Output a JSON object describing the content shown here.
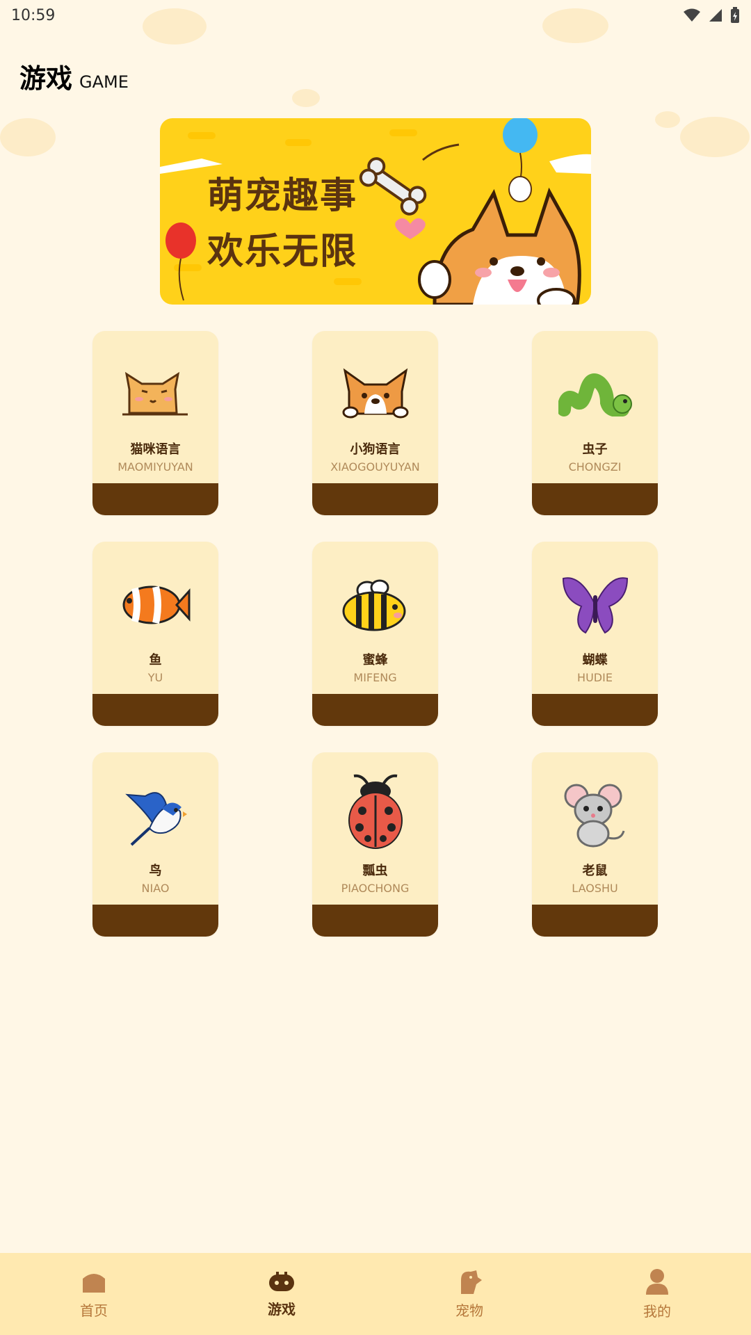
{
  "status": {
    "time": "10:59"
  },
  "header": {
    "title_cn": "游戏",
    "title_en": "GAME"
  },
  "banner": {
    "line1": "萌宠趣事",
    "line2": "欢乐无限"
  },
  "games": [
    {
      "name_cn": "猫咪语言",
      "name_en": "MAOMIYUYAN",
      "icon": "cat-icon"
    },
    {
      "name_cn": "小狗语言",
      "name_en": "XIAOGOUYUYAN",
      "icon": "dog-icon"
    },
    {
      "name_cn": "虫子",
      "name_en": "CHONGZI",
      "icon": "caterpillar-icon"
    },
    {
      "name_cn": "鱼",
      "name_en": "YU",
      "icon": "fish-icon"
    },
    {
      "name_cn": "蜜蜂",
      "name_en": "MIFENG",
      "icon": "bee-icon"
    },
    {
      "name_cn": "蝴蝶",
      "name_en": "HUDIE",
      "icon": "butterfly-icon"
    },
    {
      "name_cn": "鸟",
      "name_en": "NIAO",
      "icon": "bird-icon"
    },
    {
      "name_cn": "瓢虫",
      "name_en": "PIAOCHONG",
      "icon": "ladybug-icon"
    },
    {
      "name_cn": "老鼠",
      "name_en": "LAOSHU",
      "icon": "mouse-icon"
    }
  ],
  "nav": [
    {
      "label": "首页",
      "icon": "home-icon",
      "active": false
    },
    {
      "label": "游戏",
      "icon": "gamepad-icon",
      "active": true
    },
    {
      "label": "宠物",
      "icon": "pet-icon",
      "active": false
    },
    {
      "label": "我的",
      "icon": "user-icon",
      "active": false
    }
  ],
  "colors": {
    "background": "#fff7e6",
    "banner": "#ffd11a",
    "card": "#fdeec4",
    "card_footer": "#62380c",
    "nav_bar": "#ffe9b0",
    "text_dark": "#5a3310"
  }
}
